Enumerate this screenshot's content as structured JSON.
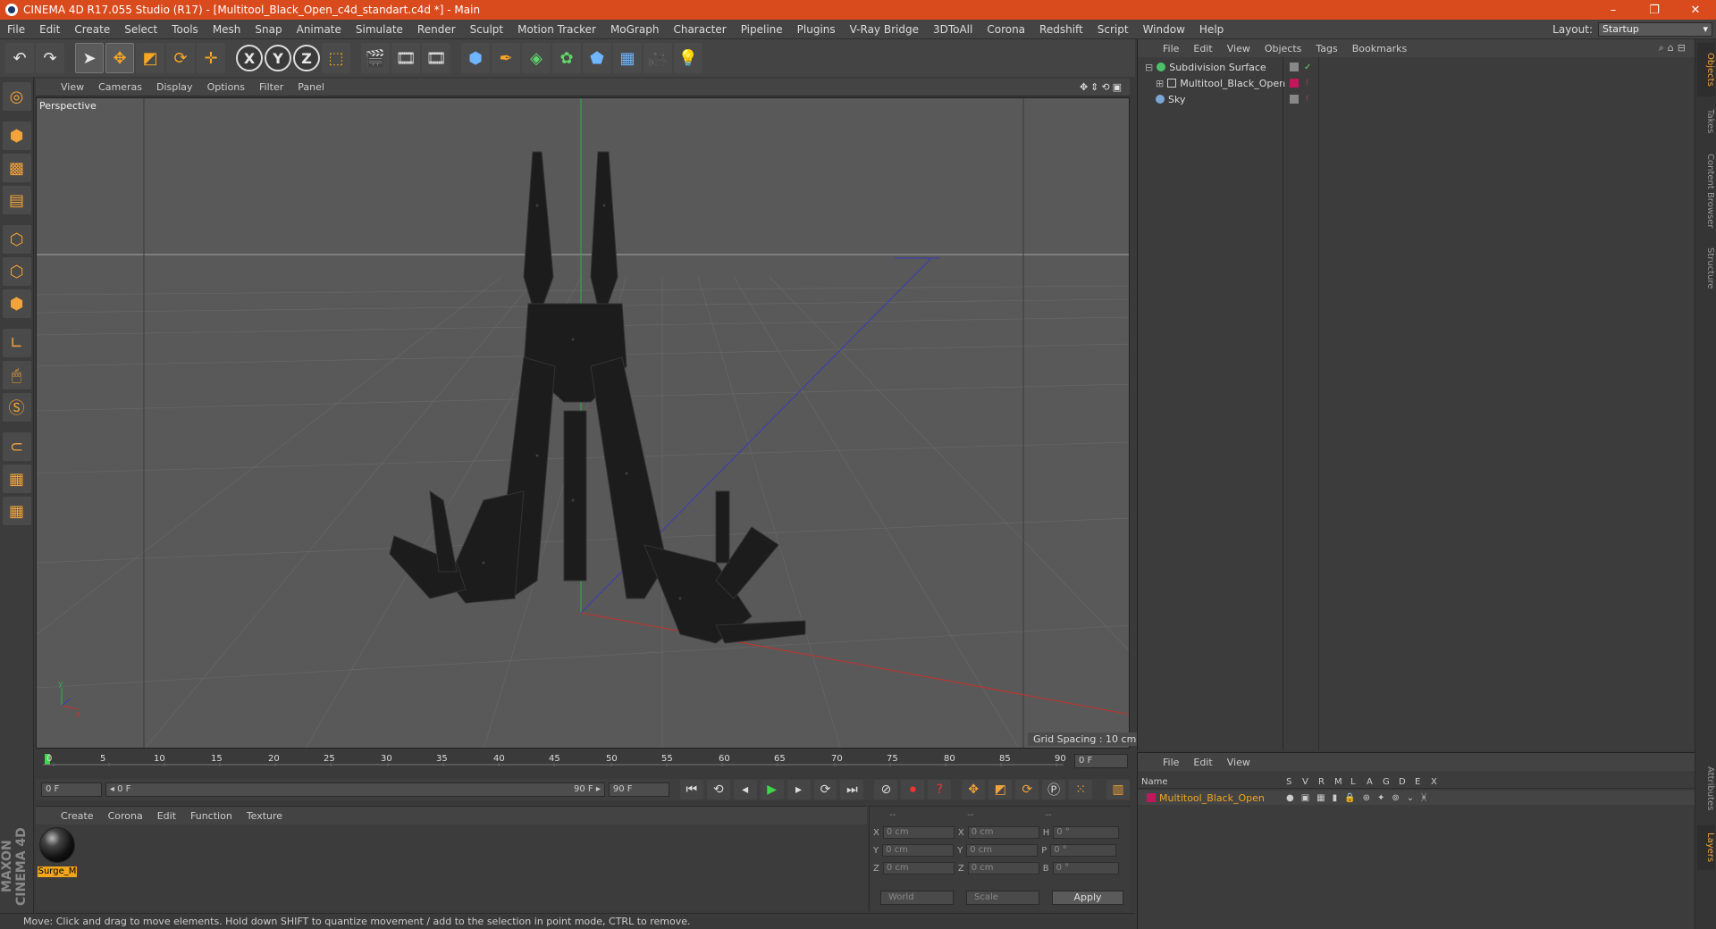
{
  "window": {
    "title": "CINEMA 4D R17.055 Studio (R17) - [Multitool_Black_Open_c4d_standart.c4d *] - Main",
    "controls": [
      "–",
      "❐",
      "✕"
    ]
  },
  "menubar": {
    "items": [
      "File",
      "Edit",
      "Create",
      "Select",
      "Tools",
      "Mesh",
      "Snap",
      "Animate",
      "Simulate",
      "Render",
      "Sculpt",
      "Motion Tracker",
      "MoGraph",
      "Character",
      "Pipeline",
      "Plugins",
      "V-Ray Bridge",
      "3DToAll",
      "Corona",
      "Redshift",
      "Script",
      "Window",
      "Help"
    ],
    "layout_label": "Layout:",
    "layout_value": "Startup"
  },
  "toolbar": {
    "undo": "↶",
    "redo": "↷",
    "x_label": "X",
    "y_label": "Y",
    "z_label": "Z"
  },
  "viewport": {
    "menu": [
      "View",
      "Cameras",
      "Display",
      "Options",
      "Filter",
      "Panel"
    ],
    "nav_icons": "✥⇕⟲▣",
    "label": "Perspective",
    "grid_spacing": "Grid Spacing : 10 cm",
    "axis_y": "y",
    "axis_z": "z"
  },
  "timeline": {
    "ticks": [
      "0",
      "5",
      "10",
      "15",
      "20",
      "25",
      "30",
      "35",
      "40",
      "45",
      "50",
      "55",
      "60",
      "65",
      "70",
      "75",
      "80",
      "85",
      "90"
    ],
    "current_frame": "0 F",
    "start_field": "0 F",
    "range_start": "◂ 0 F",
    "range_end": "90 F ▸",
    "end_field": "90 F"
  },
  "material_manager": {
    "menu": [
      "Create",
      "Corona",
      "Edit",
      "Function",
      "Texture"
    ],
    "material_name": "Surge_M"
  },
  "coordinates": {
    "headers": [
      "--",
      "--",
      "--"
    ],
    "rows": [
      {
        "a": "X",
        "av": "0 cm",
        "b": "X",
        "bv": "0 cm",
        "c": "H",
        "cv": "0 °"
      },
      {
        "a": "Y",
        "av": "0 cm",
        "b": "Y",
        "bv": "0 cm",
        "c": "P",
        "cv": "0 °"
      },
      {
        "a": "Z",
        "av": "0 cm",
        "b": "Z",
        "bv": "0 cm",
        "c": "B",
        "cv": "0 °"
      }
    ],
    "world": "World",
    "scale": "Scale",
    "apply": "Apply"
  },
  "status": "Move: Click and drag to move elements. Hold down SHIFT to quantize movement / add to the selection in point mode, CTRL to remove.",
  "object_manager": {
    "menu": [
      "File",
      "Edit",
      "View",
      "Objects",
      "Tags",
      "Bookmarks"
    ],
    "icons": "⌕⌂⊟",
    "objects": [
      {
        "name": "Subdivision Surface",
        "color": "#4fc06a"
      },
      {
        "name": "Multitool_Black_Open",
        "color": "#c0c0c0"
      },
      {
        "name": "Sky",
        "color": "#7aa6d6"
      }
    ]
  },
  "layer_manager": {
    "menu": [
      "File",
      "Edit",
      "View"
    ],
    "headers": [
      "Name",
      "S",
      "V",
      "R",
      "M",
      "L",
      "A",
      "G",
      "D",
      "E",
      "X"
    ],
    "layer_name": "Multitool_Black_Open",
    "layer_color": "#c2185b"
  },
  "right_tabs": [
    "Objects",
    "Takes",
    "Content Browser",
    "Structure",
    "Attributes",
    "Layers"
  ],
  "branding": "MAXON CINEMA 4D"
}
